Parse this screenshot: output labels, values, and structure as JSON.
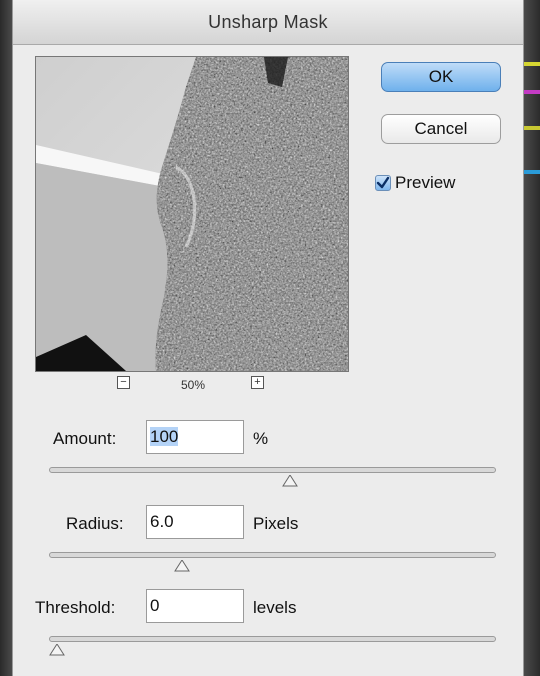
{
  "dialog": {
    "title": "Unsharp Mask"
  },
  "preview_panel": {
    "zoom_out_symbol": "−",
    "zoom_in_symbol": "+",
    "zoom_level": "50%"
  },
  "buttons": {
    "ok_label": "OK",
    "cancel_label": "Cancel"
  },
  "preview_checkbox": {
    "label": "Preview",
    "checked": true
  },
  "fields": {
    "amount": {
      "label": "Amount:",
      "value": "100",
      "unit": "%",
      "slider_fraction": 0.54
    },
    "radius": {
      "label": "Radius:",
      "value": "6.0",
      "unit": "Pixels",
      "slider_fraction": 0.29
    },
    "threshold": {
      "label": "Threshold:",
      "value": "0",
      "unit": "levels",
      "slider_fraction": 0.0
    }
  },
  "colors": {
    "ok_button": "#6fb1ec",
    "selection_highlight": "#b4d3f7",
    "dialog_background": "#ececec"
  }
}
